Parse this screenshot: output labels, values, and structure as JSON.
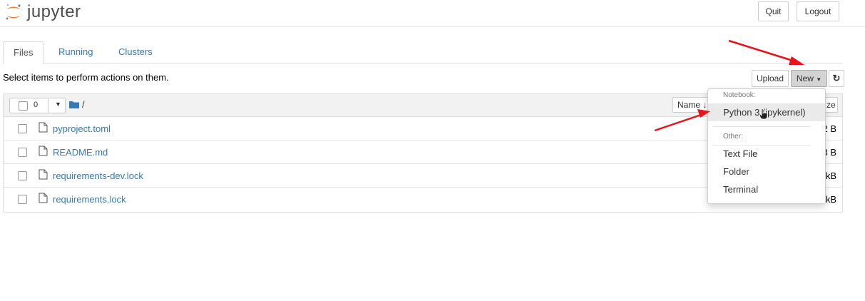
{
  "header": {
    "logo_text": "jupyter",
    "quit_label": "Quit",
    "logout_label": "Logout"
  },
  "tabs": [
    {
      "label": "Files",
      "active": true
    },
    {
      "label": "Running",
      "active": false
    },
    {
      "label": "Clusters",
      "active": false
    }
  ],
  "toolbar": {
    "instructions": "Select items to perform actions on them.",
    "upload_label": "Upload",
    "new_label": "New",
    "refresh_icon": "refresh-icon"
  },
  "list_header": {
    "selected_count": "0",
    "breadcrumb_root": "/",
    "name_sort_label": "Name",
    "size_sort_label": "ze"
  },
  "files": [
    {
      "name": "pyproject.toml",
      "size": "2 B"
    },
    {
      "name": "README.md",
      "size": "3 B"
    },
    {
      "name": "requirements-dev.lock",
      "size": "kB"
    },
    {
      "name": "requirements.lock",
      "size": "kB"
    }
  ],
  "new_menu": {
    "notebook_header": "Notebook:",
    "python_label": "Python 3 (ipykernel)",
    "other_header": "Other:",
    "text_file_label": "Text File",
    "folder_label": "Folder",
    "terminal_label": "Terminal"
  },
  "colors": {
    "link": "#337ab7",
    "annotation_arrow": "#e8141a",
    "logo_orange": "#f37726"
  }
}
